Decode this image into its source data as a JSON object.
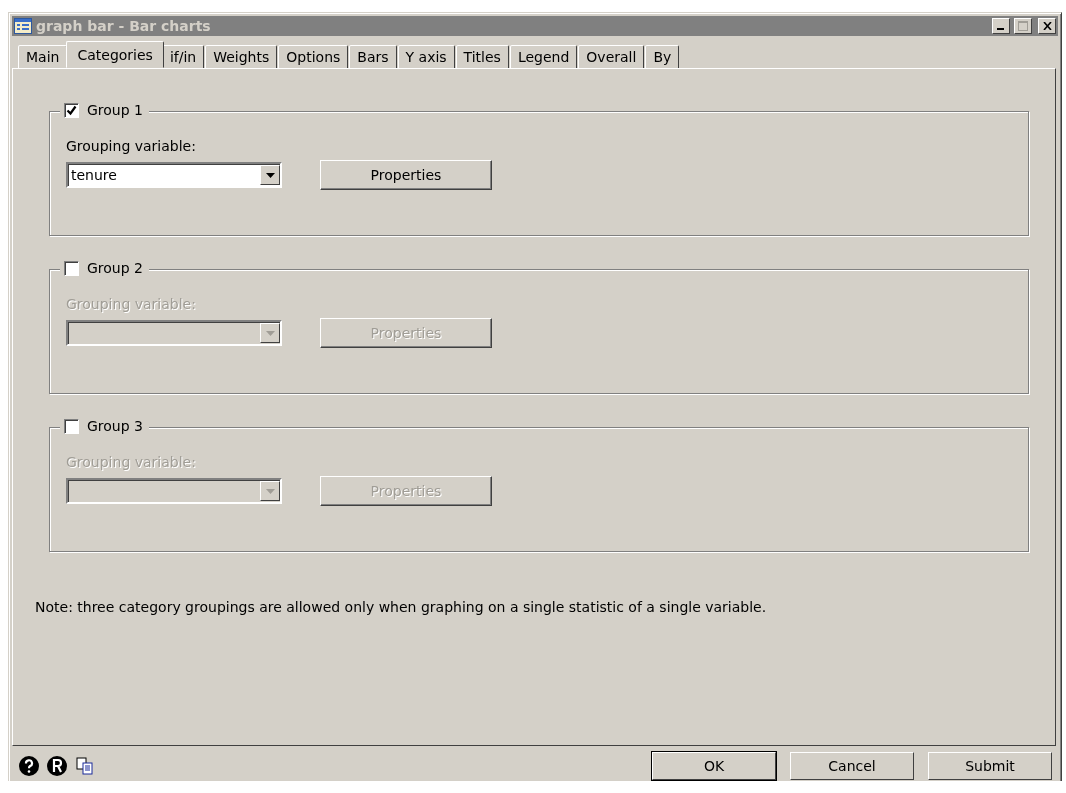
{
  "window": {
    "title": "graph bar - Bar charts"
  },
  "tabs": [
    {
      "label": "Main",
      "selected": false
    },
    {
      "label": "Categories",
      "selected": true
    },
    {
      "label": "if/in",
      "selected": false
    },
    {
      "label": "Weights",
      "selected": false
    },
    {
      "label": "Options",
      "selected": false
    },
    {
      "label": "Bars",
      "selected": false
    },
    {
      "label": "Y axis",
      "selected": false
    },
    {
      "label": "Titles",
      "selected": false
    },
    {
      "label": "Legend",
      "selected": false
    },
    {
      "label": "Overall",
      "selected": false
    },
    {
      "label": "By",
      "selected": false
    }
  ],
  "groups": [
    {
      "label": "Group 1",
      "checked": true,
      "field_label": "Grouping variable:",
      "value": "tenure",
      "button": "Properties",
      "disabled": false
    },
    {
      "label": "Group 2",
      "checked": false,
      "field_label": "Grouping variable:",
      "button": "Properties",
      "disabled": true
    },
    {
      "label": "Group 3",
      "checked": false,
      "field_label": "Grouping variable:",
      "button": "Properties",
      "disabled": true
    }
  ],
  "note": "Note: three category groupings are allowed only when graphing on a single statistic of a single variable.",
  "buttons": [
    {
      "label": "OK",
      "default": true
    },
    {
      "label": "Cancel",
      "default": false
    },
    {
      "label": "Submit",
      "default": false
    }
  ]
}
